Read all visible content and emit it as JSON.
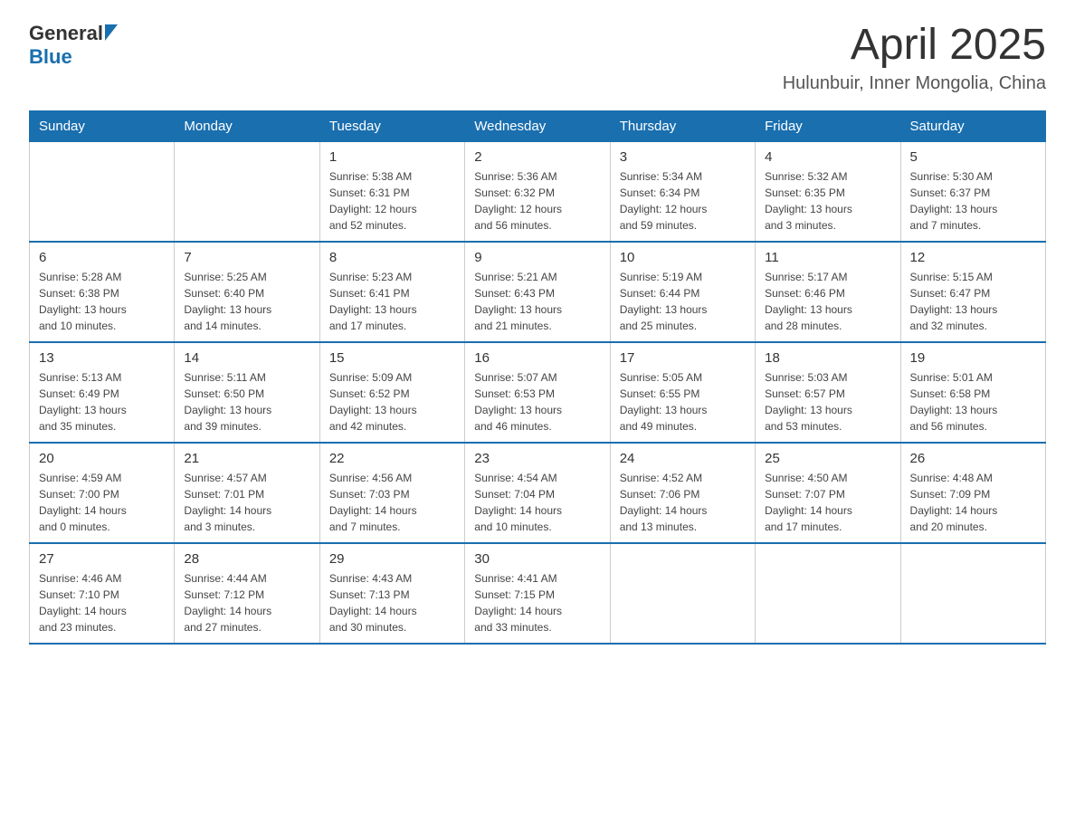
{
  "header": {
    "logo_general": "General",
    "logo_blue": "Blue",
    "month_year": "April 2025",
    "location": "Hulunbuir, Inner Mongolia, China"
  },
  "days_of_week": [
    "Sunday",
    "Monday",
    "Tuesday",
    "Wednesday",
    "Thursday",
    "Friday",
    "Saturday"
  ],
  "weeks": [
    [
      {
        "day": "",
        "info": ""
      },
      {
        "day": "",
        "info": ""
      },
      {
        "day": "1",
        "info": "Sunrise: 5:38 AM\nSunset: 6:31 PM\nDaylight: 12 hours\nand 52 minutes."
      },
      {
        "day": "2",
        "info": "Sunrise: 5:36 AM\nSunset: 6:32 PM\nDaylight: 12 hours\nand 56 minutes."
      },
      {
        "day": "3",
        "info": "Sunrise: 5:34 AM\nSunset: 6:34 PM\nDaylight: 12 hours\nand 59 minutes."
      },
      {
        "day": "4",
        "info": "Sunrise: 5:32 AM\nSunset: 6:35 PM\nDaylight: 13 hours\nand 3 minutes."
      },
      {
        "day": "5",
        "info": "Sunrise: 5:30 AM\nSunset: 6:37 PM\nDaylight: 13 hours\nand 7 minutes."
      }
    ],
    [
      {
        "day": "6",
        "info": "Sunrise: 5:28 AM\nSunset: 6:38 PM\nDaylight: 13 hours\nand 10 minutes."
      },
      {
        "day": "7",
        "info": "Sunrise: 5:25 AM\nSunset: 6:40 PM\nDaylight: 13 hours\nand 14 minutes."
      },
      {
        "day": "8",
        "info": "Sunrise: 5:23 AM\nSunset: 6:41 PM\nDaylight: 13 hours\nand 17 minutes."
      },
      {
        "day": "9",
        "info": "Sunrise: 5:21 AM\nSunset: 6:43 PM\nDaylight: 13 hours\nand 21 minutes."
      },
      {
        "day": "10",
        "info": "Sunrise: 5:19 AM\nSunset: 6:44 PM\nDaylight: 13 hours\nand 25 minutes."
      },
      {
        "day": "11",
        "info": "Sunrise: 5:17 AM\nSunset: 6:46 PM\nDaylight: 13 hours\nand 28 minutes."
      },
      {
        "day": "12",
        "info": "Sunrise: 5:15 AM\nSunset: 6:47 PM\nDaylight: 13 hours\nand 32 minutes."
      }
    ],
    [
      {
        "day": "13",
        "info": "Sunrise: 5:13 AM\nSunset: 6:49 PM\nDaylight: 13 hours\nand 35 minutes."
      },
      {
        "day": "14",
        "info": "Sunrise: 5:11 AM\nSunset: 6:50 PM\nDaylight: 13 hours\nand 39 minutes."
      },
      {
        "day": "15",
        "info": "Sunrise: 5:09 AM\nSunset: 6:52 PM\nDaylight: 13 hours\nand 42 minutes."
      },
      {
        "day": "16",
        "info": "Sunrise: 5:07 AM\nSunset: 6:53 PM\nDaylight: 13 hours\nand 46 minutes."
      },
      {
        "day": "17",
        "info": "Sunrise: 5:05 AM\nSunset: 6:55 PM\nDaylight: 13 hours\nand 49 minutes."
      },
      {
        "day": "18",
        "info": "Sunrise: 5:03 AM\nSunset: 6:57 PM\nDaylight: 13 hours\nand 53 minutes."
      },
      {
        "day": "19",
        "info": "Sunrise: 5:01 AM\nSunset: 6:58 PM\nDaylight: 13 hours\nand 56 minutes."
      }
    ],
    [
      {
        "day": "20",
        "info": "Sunrise: 4:59 AM\nSunset: 7:00 PM\nDaylight: 14 hours\nand 0 minutes."
      },
      {
        "day": "21",
        "info": "Sunrise: 4:57 AM\nSunset: 7:01 PM\nDaylight: 14 hours\nand 3 minutes."
      },
      {
        "day": "22",
        "info": "Sunrise: 4:56 AM\nSunset: 7:03 PM\nDaylight: 14 hours\nand 7 minutes."
      },
      {
        "day": "23",
        "info": "Sunrise: 4:54 AM\nSunset: 7:04 PM\nDaylight: 14 hours\nand 10 minutes."
      },
      {
        "day": "24",
        "info": "Sunrise: 4:52 AM\nSunset: 7:06 PM\nDaylight: 14 hours\nand 13 minutes."
      },
      {
        "day": "25",
        "info": "Sunrise: 4:50 AM\nSunset: 7:07 PM\nDaylight: 14 hours\nand 17 minutes."
      },
      {
        "day": "26",
        "info": "Sunrise: 4:48 AM\nSunset: 7:09 PM\nDaylight: 14 hours\nand 20 minutes."
      }
    ],
    [
      {
        "day": "27",
        "info": "Sunrise: 4:46 AM\nSunset: 7:10 PM\nDaylight: 14 hours\nand 23 minutes."
      },
      {
        "day": "28",
        "info": "Sunrise: 4:44 AM\nSunset: 7:12 PM\nDaylight: 14 hours\nand 27 minutes."
      },
      {
        "day": "29",
        "info": "Sunrise: 4:43 AM\nSunset: 7:13 PM\nDaylight: 14 hours\nand 30 minutes."
      },
      {
        "day": "30",
        "info": "Sunrise: 4:41 AM\nSunset: 7:15 PM\nDaylight: 14 hours\nand 33 minutes."
      },
      {
        "day": "",
        "info": ""
      },
      {
        "day": "",
        "info": ""
      },
      {
        "day": "",
        "info": ""
      }
    ]
  ]
}
